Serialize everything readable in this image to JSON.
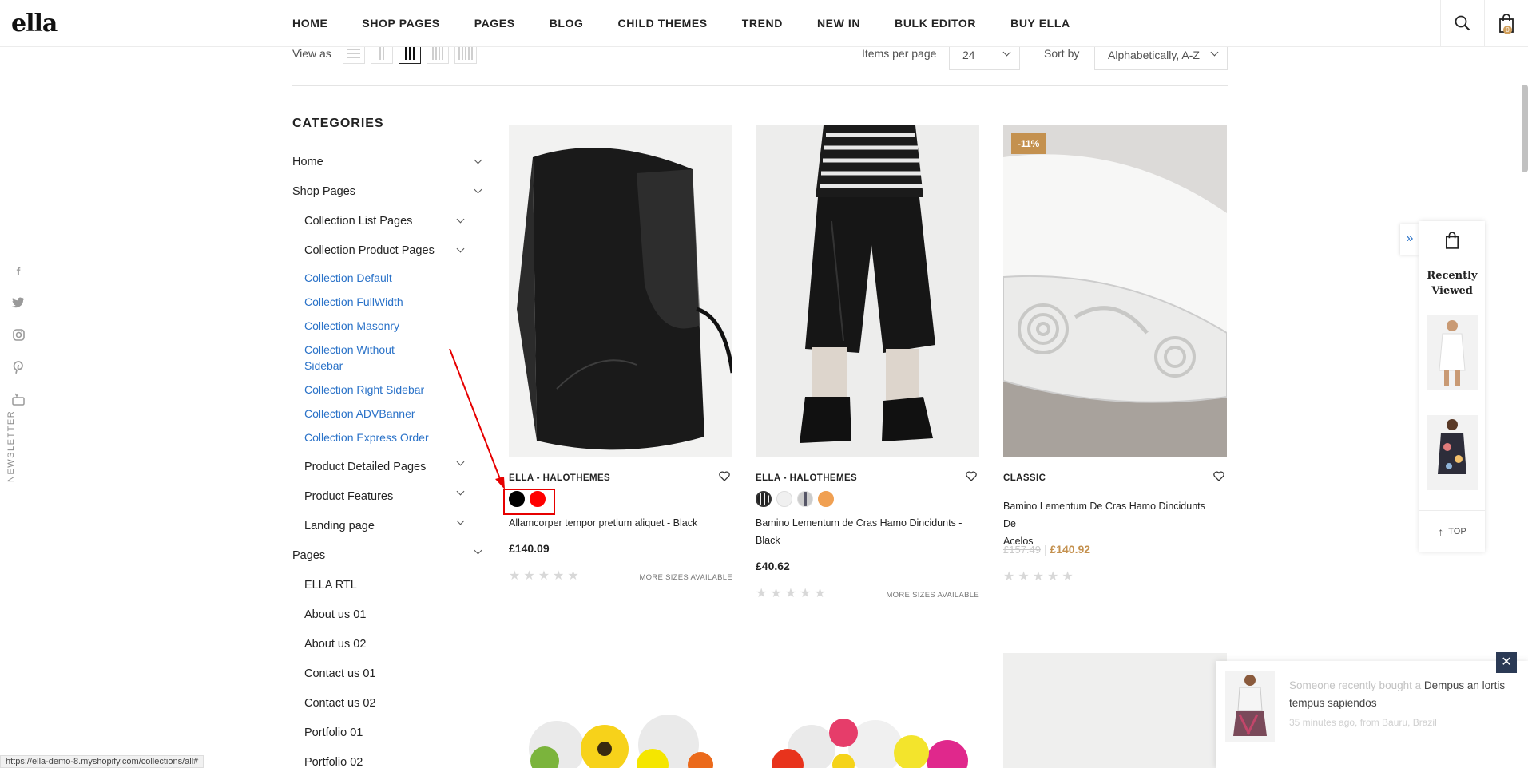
{
  "header": {
    "logo": "ella",
    "nav": [
      "HOME",
      "SHOP PAGES",
      "PAGES",
      "BLOG",
      "CHILD THEMES",
      "TREND",
      "NEW IN",
      "BULK EDITOR",
      "BUY ELLA"
    ],
    "cart_count": "0"
  },
  "toolbar": {
    "view_label": "View as",
    "items_per_page_label": "Items per page",
    "items_per_page_value": "24",
    "sort_label": "Sort by",
    "sort_value": "Alphabetically, A-Z"
  },
  "sidebar": {
    "newsletter": "NEWSLETTER",
    "categories_title": "CATEGORIES",
    "items": {
      "home": "Home",
      "shop_pages": "Shop Pages",
      "collection_list_pages": "Collection List Pages",
      "collection_product_pages": "Collection Product Pages",
      "collection_default": "Collection Default",
      "collection_fullwidth": "Collection FullWidth",
      "collection_masonry": "Collection Masonry",
      "collection_without_sidebar_1": "Collection Without",
      "collection_without_sidebar_2": "Sidebar",
      "collection_right_sidebar": "Collection Right Sidebar",
      "collection_advbanner": "Collection ADVBanner",
      "collection_express_order": "Collection Express Order",
      "product_detailed_pages": "Product Detailed Pages",
      "product_features": "Product Features",
      "landing_page": "Landing page",
      "pages": "Pages",
      "ella_rtl": "ELLA RTL",
      "about_01": "About us 01",
      "about_02": "About us 02",
      "contact_01": "Contact us 01",
      "contact_02": "Contact us 02",
      "portfolio_01": "Portfolio 01",
      "portfolio_02": "Portfolio 02"
    }
  },
  "products": [
    {
      "vendor": "ELLA - HALOTHEMES",
      "title": "Allamcorper tempor pretium aliquet - Black",
      "price": "£140.09",
      "more_sizes": "MORE SIZES AVAILABLE",
      "swatch_colors": [
        "#000000",
        "#ff0000"
      ]
    },
    {
      "vendor": "ELLA - HALOTHEMES",
      "title_line1": "Bamino Lementum de Cras Hamo Dincidunts -",
      "title_line2": "Black",
      "price": "£40.62",
      "more_sizes": "MORE SIZES AVAILABLE"
    },
    {
      "badge": "-11%",
      "vendor": "CLASSIC",
      "title_line1": "Bamino Lementum De Cras Hamo Dincidunts De",
      "title_line2": "Acelos",
      "old_price": "£157.49",
      "price": "£140.92"
    }
  ],
  "recently_viewed": {
    "title_line1": "Recently",
    "title_line2": "Viewed",
    "top_label": "TOP"
  },
  "popup": {
    "prefix": "Someone recently bought a",
    "product": "Dempus an lortis tempus sapiendos",
    "meta": "35 minutes ago, from Bauru, Brazil"
  },
  "status_url": "https://ella-demo-8.myshopify.com/collections/all#",
  "colors": {
    "accent": "#c4914f",
    "link": "#2a72c8",
    "annotation": "#e60000"
  }
}
